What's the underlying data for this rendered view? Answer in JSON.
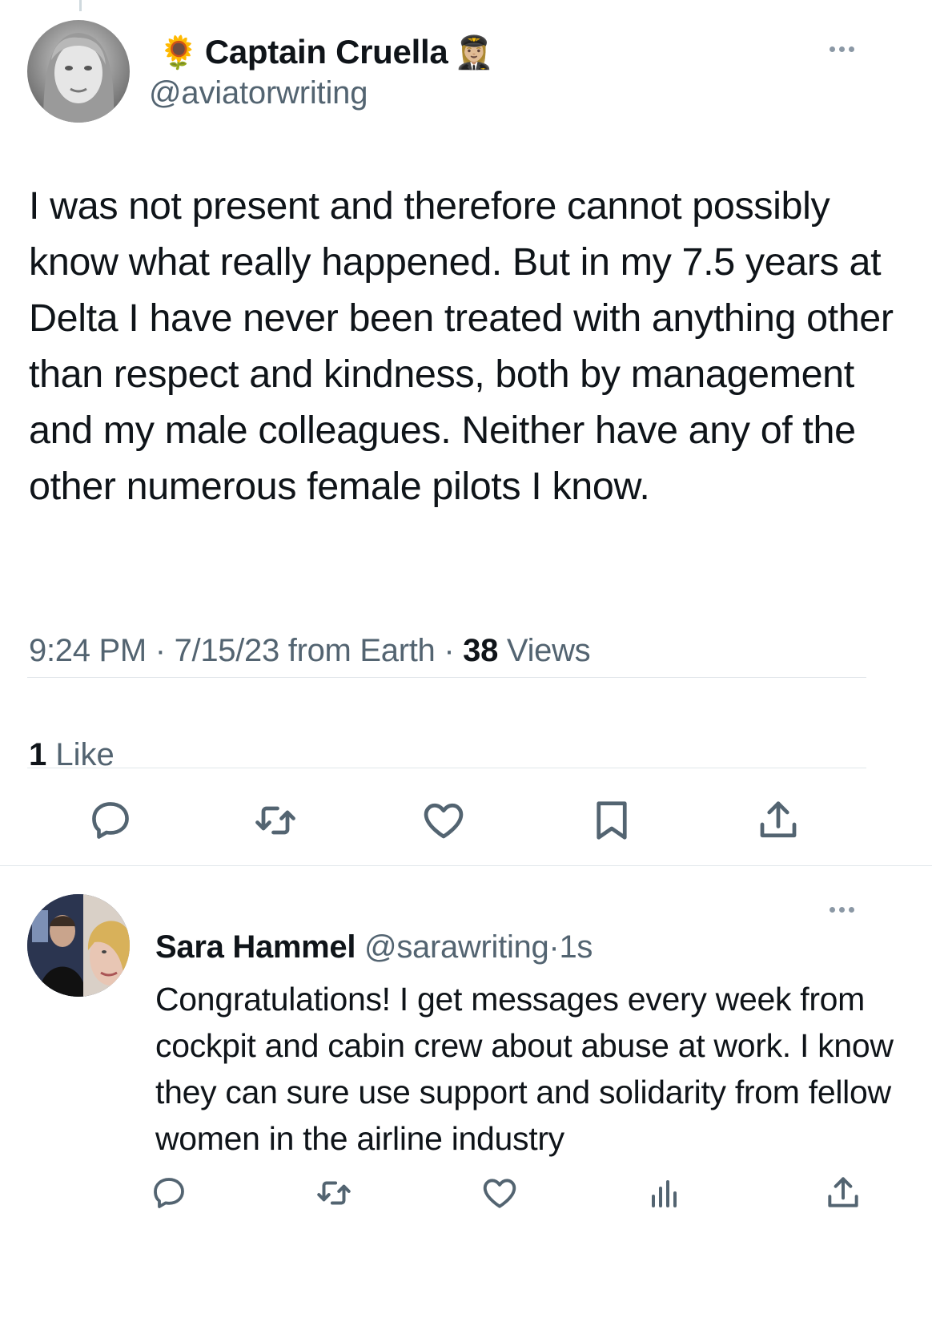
{
  "tweet": {
    "author_emoji_left": "🌻",
    "author_name": "Captain Cruella",
    "author_emoji_right": "👩🏼‍✈️",
    "handle": "@aviatorwriting",
    "text": "I was not present and therefore cannot possibly know what really happened. But in my 7.5 years at Delta I have never been treated with anything other than respect and kindness, both by management and my male colleagues. Neither have any of the other numerous female pilots I know.",
    "time": "9:24 PM",
    "date": "7/15/23",
    "source": "from Earth",
    "separator": "·",
    "views_count": "38",
    "views_label": "Views",
    "likes_count": "1",
    "likes_label": "Like"
  },
  "reply": {
    "name": "Sara Hammel",
    "handle": "@sarawriting",
    "separator": "·",
    "time": "1s",
    "text": "Congratulations! I get messages every week from cockpit and cabin crew about abuse at work. I know they can sure use support and solidarity from fellow women in the airline industry"
  },
  "icons": {
    "main_actions": [
      "reply-icon",
      "retweet-icon",
      "like-icon",
      "bookmark-icon",
      "share-icon"
    ],
    "reply_actions": [
      "reply-icon",
      "retweet-icon",
      "like-icon",
      "views-icon",
      "share-icon"
    ],
    "more": "more-icon"
  },
  "colors": {
    "text": "#0f1419",
    "secondary": "#536471",
    "divider": "#e1e6ea"
  }
}
